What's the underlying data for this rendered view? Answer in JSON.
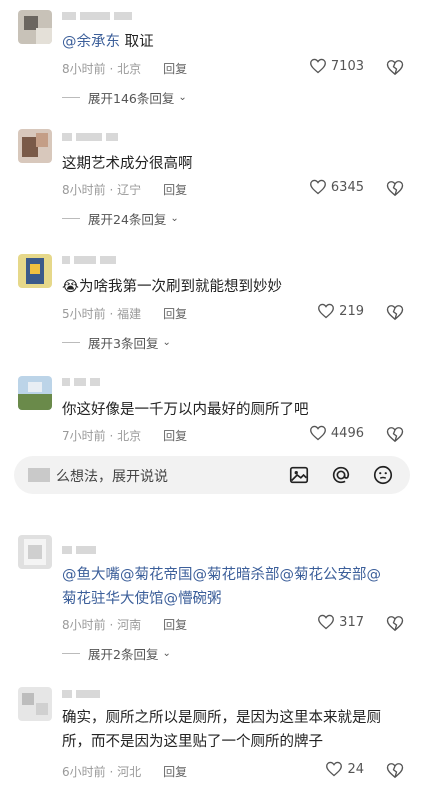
{
  "comments": [
    {
      "text_parts": [
        {
          "t": "@余承东",
          "m": true
        },
        {
          "t": " 取证",
          "m": false
        }
      ],
      "time": "8小时前",
      "location": "北京",
      "reply_label": "回复",
      "likes": "7103",
      "expand_label": "展开146条回复"
    },
    {
      "text_parts": [
        {
          "t": "这期艺术成分很高啊",
          "m": false
        }
      ],
      "time": "8小时前",
      "location": "辽宁",
      "reply_label": "回复",
      "likes": "6345",
      "expand_label": "展开24条回复"
    },
    {
      "emoji": "😭",
      "text_parts": [
        {
          "t": "为啥我第一次刷到就能想到妙妙",
          "m": false
        }
      ],
      "time": "5小时前",
      "location": "福建",
      "reply_label": "回复",
      "likes": "219",
      "expand_label": "展开3条回复"
    },
    {
      "text_parts": [
        {
          "t": "你这好像是一千万以内最好的厕所了吧",
          "m": false
        }
      ],
      "time": "7小时前",
      "location": "北京",
      "reply_label": "回复",
      "likes": "4496"
    },
    {
      "line1": "@鱼大嘴@菊花帝国@菊花暗杀部@菊花公安部@",
      "line2": "菊花驻华大使馆@懵碗粥",
      "time": "8小时前",
      "location": "河南",
      "reply_label": "回复",
      "likes": "317",
      "expand_label": "展开2条回复"
    },
    {
      "line1": "确实，厕所之所以是厕所，是因为这里本来就是厕",
      "line2": "所，而不是因为这里贴了一个厕所的牌子",
      "time": "6小时前",
      "location": "河北",
      "reply_label": "回复",
      "likes": "24"
    }
  ],
  "input": {
    "placeholder": "么想法，展开说说"
  },
  "icons": {
    "like": "heart-icon",
    "dislike": "broken-heart-icon",
    "image": "image-icon",
    "at": "at-icon",
    "emoji": "smiley-icon",
    "chevron": "chevron-down-icon"
  }
}
